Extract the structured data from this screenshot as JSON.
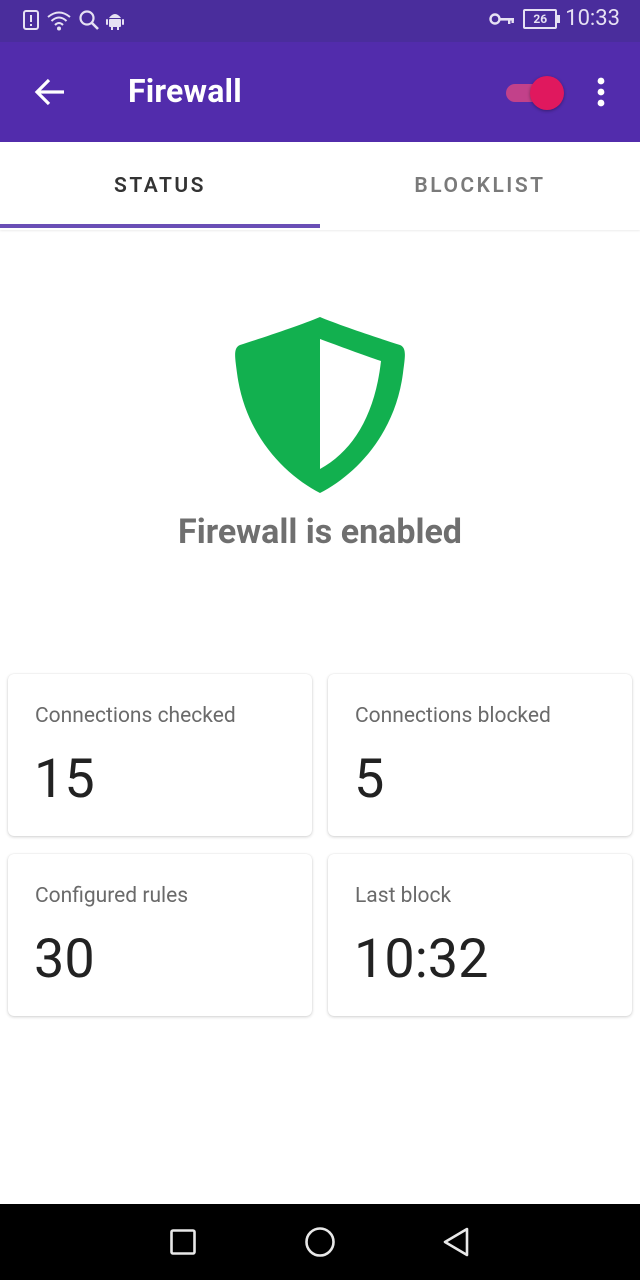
{
  "status_bar": {
    "time": "10:33",
    "battery": "26",
    "icons": [
      "alert-icon",
      "wifi-icon",
      "search-icon",
      "android-icon",
      "vpn-key-icon"
    ]
  },
  "app_bar": {
    "title": "Firewall",
    "toggle_on": true,
    "colors": {
      "background": "#522cac",
      "toggle_thumb": "#e0185e"
    }
  },
  "tabs": [
    {
      "label": "STATUS",
      "selected": true
    },
    {
      "label": "BLOCKLIST",
      "selected": false
    }
  ],
  "status": {
    "message": "Firewall is enabled",
    "shield_color": "#12b04f"
  },
  "stats": [
    {
      "label": "Connections checked",
      "value": "15"
    },
    {
      "label": "Connections blocked",
      "value": "5"
    },
    {
      "label": "Configured rules",
      "value": "30"
    },
    {
      "label": "Last block",
      "value": "10:32"
    }
  ],
  "nav_bar": {
    "icons": [
      "recents-icon",
      "home-icon",
      "back-nav-icon"
    ]
  }
}
